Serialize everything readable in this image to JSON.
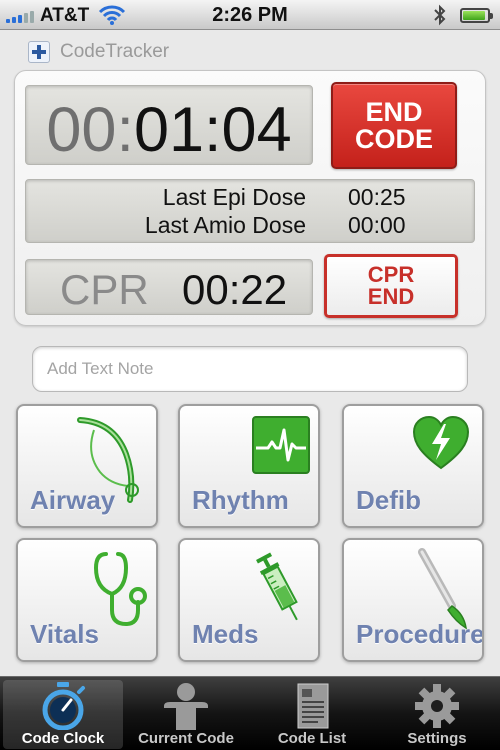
{
  "status_bar": {
    "carrier": "AT&T",
    "time": "2:26 PM",
    "battery_level": 0.9
  },
  "app": {
    "title": "CodeTracker"
  },
  "timer": {
    "dim_part": "00:",
    "main_part": "01:04",
    "end_button_line1": "END",
    "end_button_line2": "CODE"
  },
  "doses": {
    "epi_label": "Last Epi Dose",
    "epi_time": "00:25",
    "amio_label": "Last Amio Dose",
    "amio_time": "00:00"
  },
  "cpr": {
    "label": "CPR",
    "time": "00:22",
    "end_button_line1": "CPR",
    "end_button_line2": "END"
  },
  "note": {
    "placeholder": "Add Text Note"
  },
  "tiles": {
    "airway": "Airway",
    "rhythm": "Rhythm",
    "defib": "Defib",
    "vitals": "Vitals",
    "meds": "Meds",
    "procedure": "Procedure"
  },
  "tabbar": {
    "code_clock": "Code Clock",
    "current_code": "Current Code",
    "code_list": "Code List",
    "settings": "Settings",
    "active": "code_clock"
  },
  "colors": {
    "end_red": "#d0322a",
    "tile_label": "#6f82b0",
    "icon_green": "#3fae2f"
  }
}
